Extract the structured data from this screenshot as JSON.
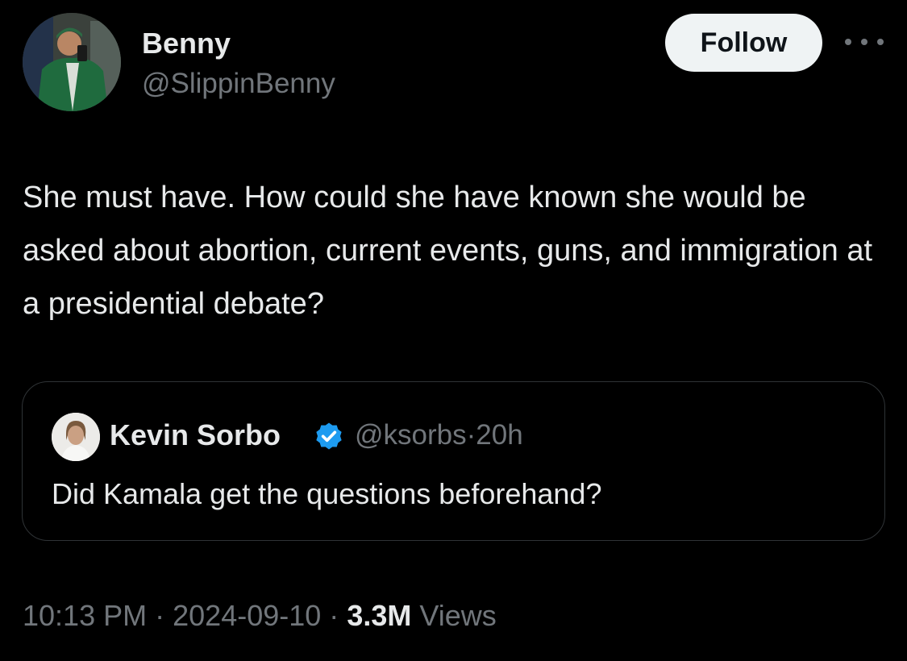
{
  "author": {
    "name": "Benny",
    "handle": "@SlippinBenny",
    "avatar_icon": "profile-photo-man-green-jacket"
  },
  "actions": {
    "follow_label": "Follow",
    "more_icon": "more-horizontal-icon"
  },
  "tweet": {
    "text": "She must have. How could she have known she would be asked about abortion, current events, guns, and immigration at a presidential debate?"
  },
  "quoted_tweet": {
    "name": "Kevin Sorbo",
    "verified": true,
    "verified_color": "#1d9bf0",
    "handle": "@ksorbs",
    "separator": "·",
    "age": "20h",
    "text": "Did Kamala get the questions beforehand?",
    "avatar_icon": "profile-photo-man"
  },
  "meta": {
    "time": "10:13 PM",
    "sep1": "·",
    "date": "2024-09-10",
    "sep2": "·",
    "views_count": "3.3M",
    "views_label": "Views"
  },
  "colors": {
    "background": "#000000",
    "primary_text": "#e7e9ea",
    "secondary_text": "#71767b",
    "border": "#2f3336",
    "follow_bg": "#eff3f4"
  }
}
